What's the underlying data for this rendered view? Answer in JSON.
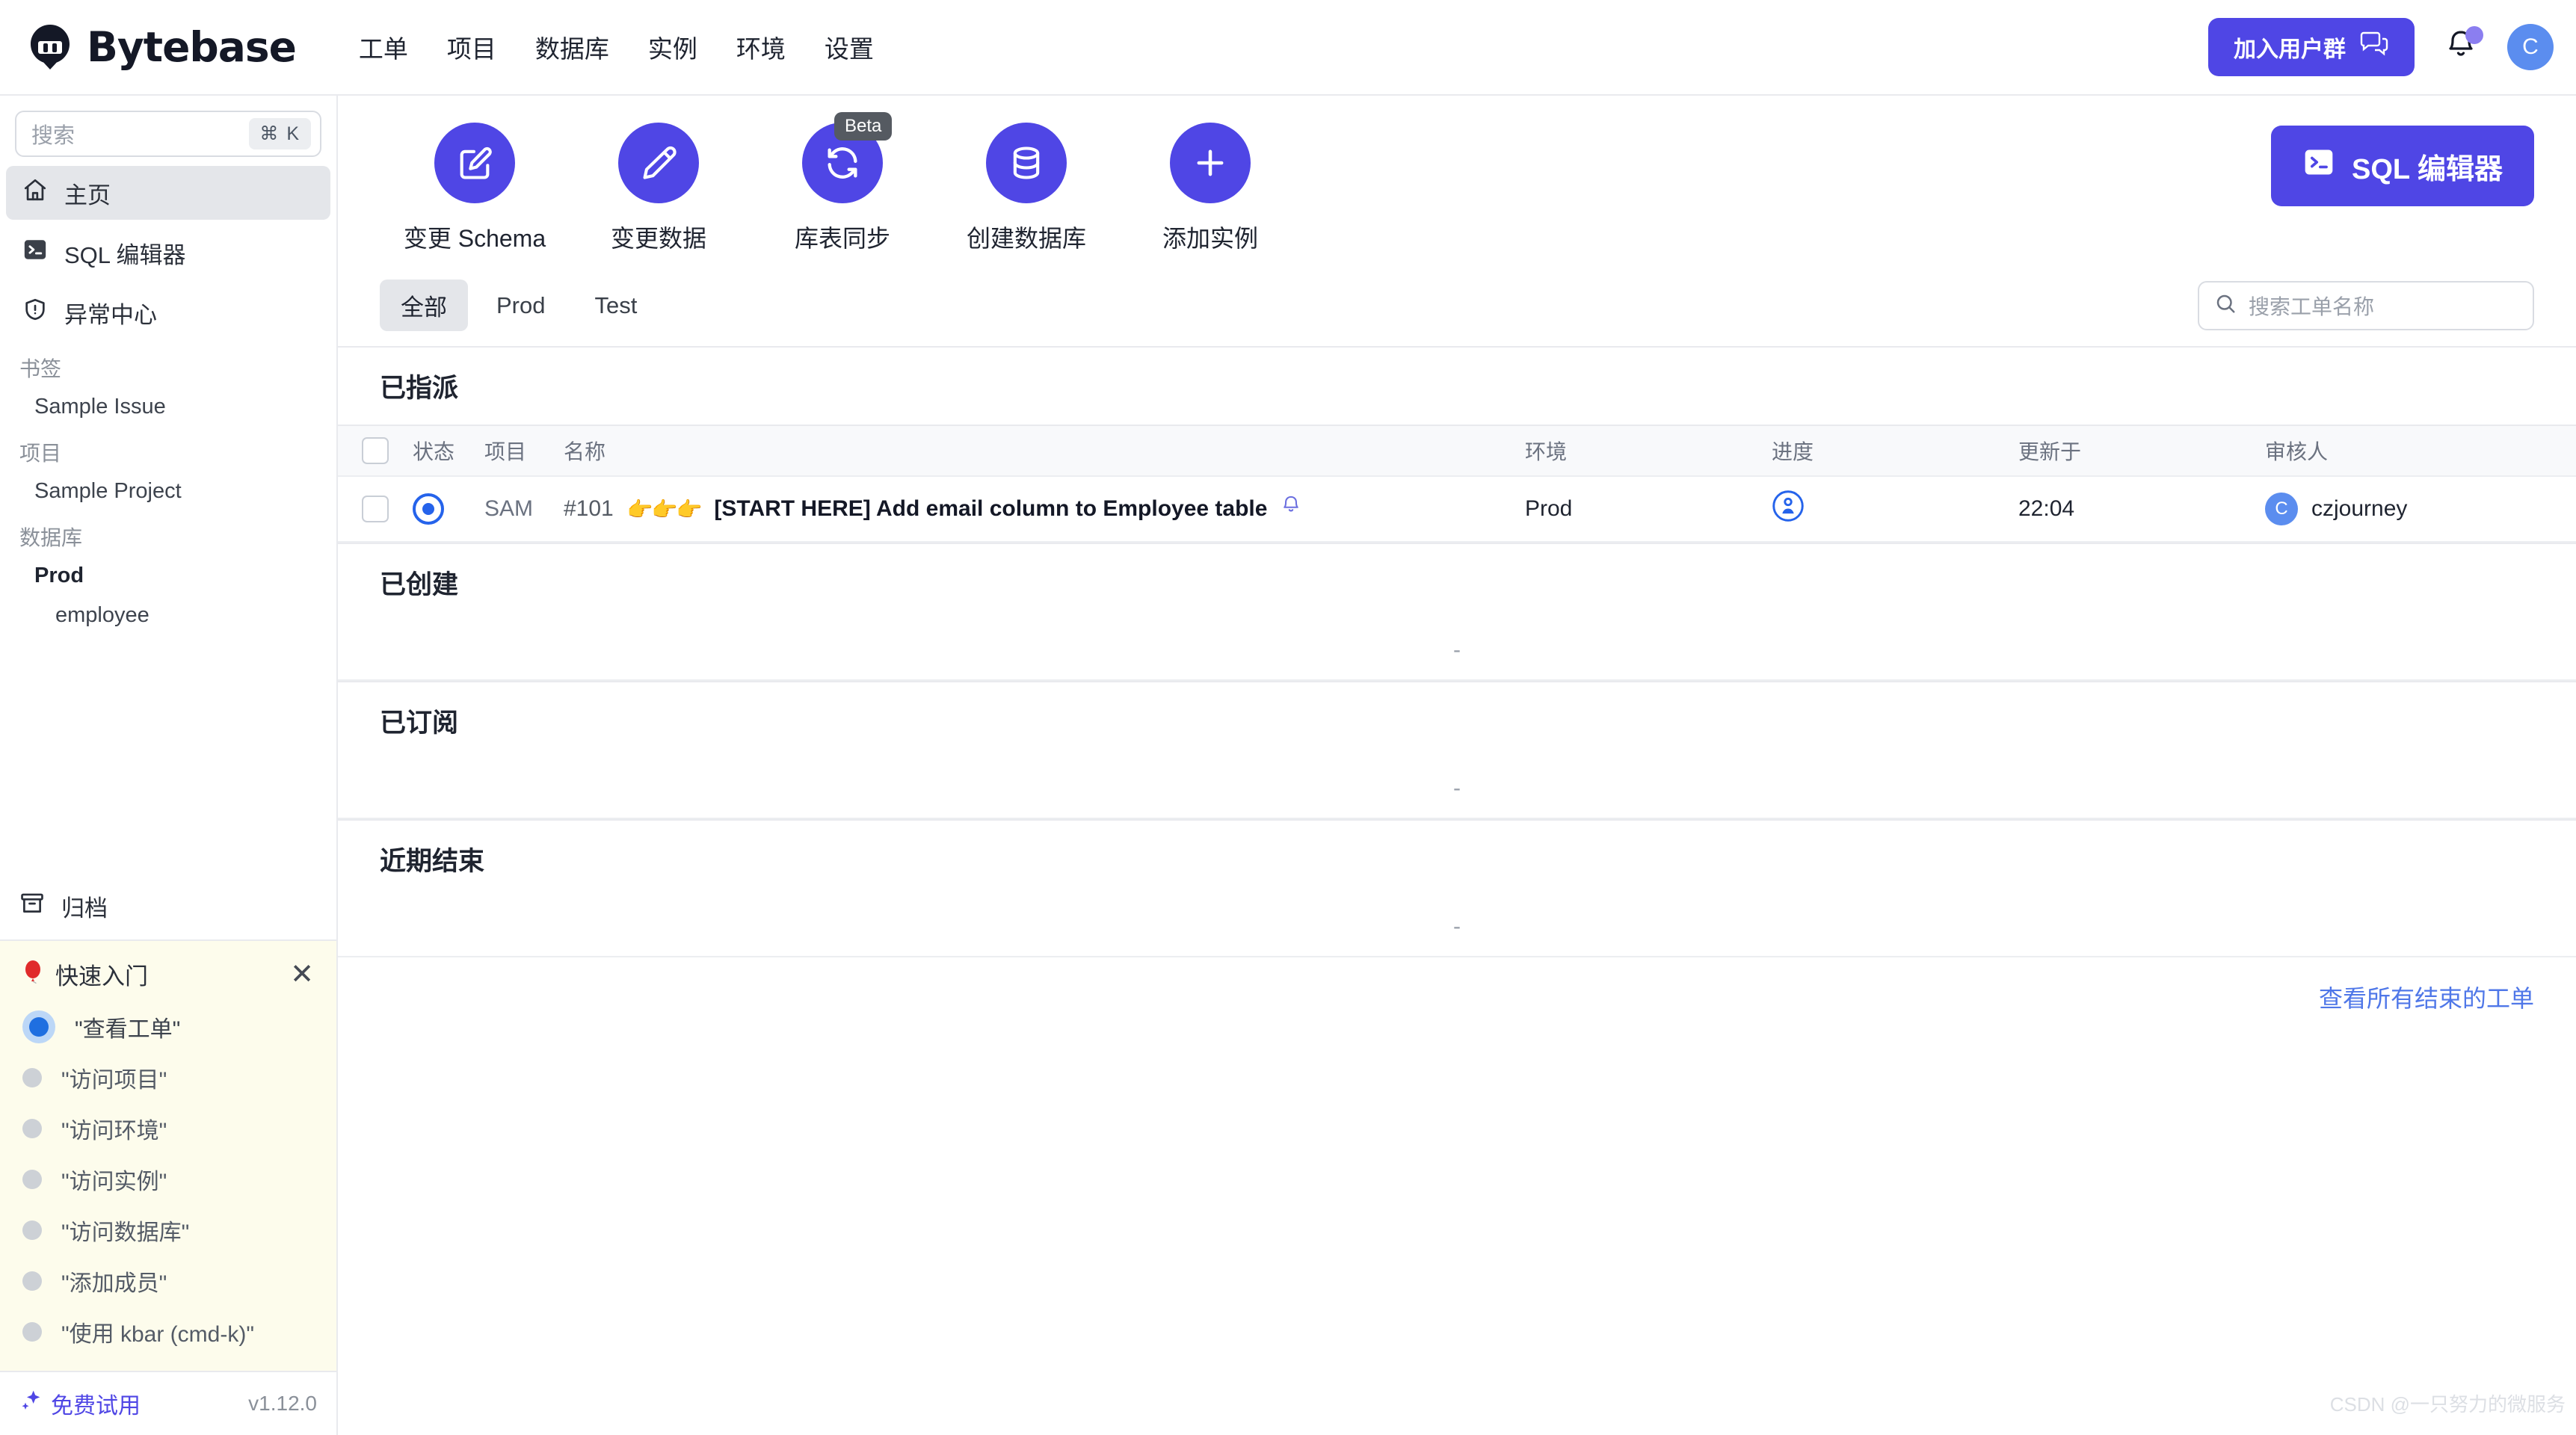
{
  "app": {
    "brand": "Bytebase",
    "version": "v1.12.0",
    "watermark": "CSDN @一只努力的微服务"
  },
  "topnav": {
    "items": [
      {
        "label": "工单",
        "name": "nav-issues"
      },
      {
        "label": "项目",
        "name": "nav-projects"
      },
      {
        "label": "数据库",
        "name": "nav-databases"
      },
      {
        "label": "实例",
        "name": "nav-instances"
      },
      {
        "label": "环境",
        "name": "nav-environments"
      },
      {
        "label": "设置",
        "name": "nav-settings"
      }
    ],
    "join_button": "加入用户群",
    "avatar_initial": "C"
  },
  "sidebar": {
    "search_placeholder": "搜索",
    "search_shortcut": "⌘ K",
    "primary": [
      {
        "label": "主页",
        "icon": "home-icon",
        "active": true
      },
      {
        "label": "SQL 编辑器",
        "icon": "terminal-icon",
        "active": false
      },
      {
        "label": "异常中心",
        "icon": "shield-alert-icon",
        "active": false
      }
    ],
    "groups": [
      {
        "label": "书签",
        "items": [
          {
            "label": "Sample Issue",
            "bold": false,
            "indent": 1
          }
        ]
      },
      {
        "label": "项目",
        "items": [
          {
            "label": "Sample Project",
            "bold": false,
            "indent": 1
          }
        ]
      },
      {
        "label": "数据库",
        "items": [
          {
            "label": "Prod",
            "bold": true,
            "indent": 1
          },
          {
            "label": "employee",
            "bold": false,
            "indent": 2
          }
        ]
      }
    ],
    "archive_label": "归档",
    "trial_label": "免费试用"
  },
  "quickstart": {
    "title": "快速入门",
    "items": [
      {
        "label": "\"查看工单\"",
        "current": true
      },
      {
        "label": "\"访问项目\"",
        "current": false
      },
      {
        "label": "\"访问环境\"",
        "current": false
      },
      {
        "label": "\"访问实例\"",
        "current": false
      },
      {
        "label": "\"访问数据库\"",
        "current": false
      },
      {
        "label": "\"添加成员\"",
        "current": false
      },
      {
        "label": "\"使用 kbar (cmd-k)\"",
        "current": false
      }
    ]
  },
  "quick_actions": {
    "items": [
      {
        "label": "变更 Schema",
        "icon": "edit-square-icon",
        "badge": ""
      },
      {
        "label": "变更数据",
        "icon": "pencil-icon",
        "badge": ""
      },
      {
        "label": "库表同步",
        "icon": "sync-icon",
        "badge": "Beta"
      },
      {
        "label": "创建数据库",
        "icon": "database-icon",
        "badge": ""
      },
      {
        "label": "添加实例",
        "icon": "plus-icon",
        "badge": ""
      }
    ],
    "sql_editor_button": "SQL 编辑器"
  },
  "filters": {
    "chips": [
      {
        "label": "全部",
        "active": true
      },
      {
        "label": "Prod",
        "active": false
      },
      {
        "label": "Test",
        "active": false
      }
    ],
    "search_placeholder": "搜索工单名称"
  },
  "table": {
    "columns": {
      "status": "状态",
      "project": "项目",
      "name": "名称",
      "environment": "环境",
      "progress": "进度",
      "updated": "更新于",
      "approver": "审核人"
    }
  },
  "sections": [
    {
      "title": "已指派",
      "has_header": true,
      "empty_text": "",
      "rows": [
        {
          "status": "open",
          "project": "SAM",
          "issue_id": "#101",
          "emoji": "👉👉👉",
          "title": "[START HERE] Add email column to Employee table",
          "bell": "bell-icon",
          "environment": "Prod",
          "progress_icon": "person-pending-icon",
          "updated": "22:04",
          "approver_initial": "C",
          "approver": "czjourney"
        }
      ]
    },
    {
      "title": "已创建",
      "has_header": false,
      "empty_text": "-",
      "rows": []
    },
    {
      "title": "已订阅",
      "has_header": false,
      "empty_text": "-",
      "rows": []
    },
    {
      "title": "近期结束",
      "has_header": false,
      "empty_text": "-",
      "rows": []
    }
  ],
  "footer": {
    "view_all_closed": "查看所有结束的工单"
  },
  "colors": {
    "accent": "#4f46e5",
    "link": "#4f77e8",
    "status_blue": "#2563eb",
    "avatar_blue": "#5b8def",
    "quickstart_bg": "#fdfcec"
  }
}
